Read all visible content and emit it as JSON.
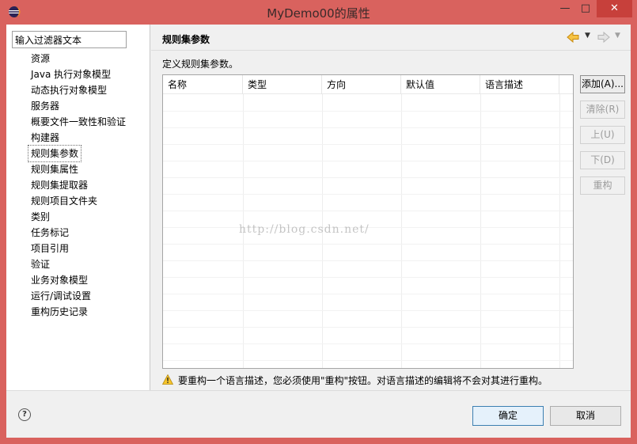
{
  "window": {
    "title": "MyDemo00的属性",
    "min_glyph": "—",
    "max_glyph": "□",
    "close_glyph": "✕"
  },
  "filter": {
    "value": "输入过滤器文本"
  },
  "tree": {
    "items": [
      {
        "label": "资源"
      },
      {
        "label": "Java 执行对象模型"
      },
      {
        "label": "动态执行对象模型"
      },
      {
        "label": "服务器"
      },
      {
        "label": "概要文件一致性和验证"
      },
      {
        "label": "构建器"
      },
      {
        "label": "规则集参数",
        "selected": true
      },
      {
        "label": "规则集属性"
      },
      {
        "label": "规则集提取器"
      },
      {
        "label": "规则项目文件夹"
      },
      {
        "label": "类别"
      },
      {
        "label": "任务标记"
      },
      {
        "label": "项目引用"
      },
      {
        "label": "验证"
      },
      {
        "label": "业务对象模型"
      },
      {
        "label": "运行/调试设置"
      },
      {
        "label": "重构历史记录"
      }
    ]
  },
  "page": {
    "title": "规则集参数",
    "description": "定义规则集参数。",
    "nav_back_dropdown": "▼",
    "nav_fwd_dropdown": "▼"
  },
  "table": {
    "columns": [
      "名称",
      "类型",
      "方向",
      "默认值",
      "语言描述"
    ],
    "rows": []
  },
  "buttons": {
    "add": "添加(A)...",
    "clear": "清除(R)",
    "up": "上(U)",
    "down": "下(D)",
    "refactor": "重构"
  },
  "warning": {
    "text": "要重构一个语言描述，您必须使用\"重构\"按钮。对语言描述的编辑将不会对其进行重构。"
  },
  "dialog": {
    "help": "?",
    "ok": "确定",
    "cancel": "取消"
  },
  "watermark": "http://blog.csdn.net/",
  "colors": {
    "titlebar": "#d9625e",
    "close_button": "#c7403b",
    "accent_arrow": "#e8a21a"
  }
}
